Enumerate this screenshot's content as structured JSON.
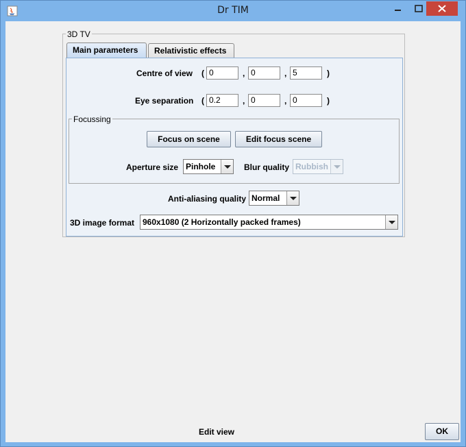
{
  "window": {
    "title": "Dr TIM"
  },
  "titlebar": {
    "minimize_icon": "minimize-icon",
    "maximize_icon": "maximize-icon",
    "close_icon": "close-icon"
  },
  "group": {
    "title": "3D TV"
  },
  "tabs": [
    {
      "label": "Main parameters",
      "selected": true
    },
    {
      "label": "Relativistic effects",
      "selected": false
    }
  ],
  "centre_of_view": {
    "label": "Centre of view",
    "x": "0",
    "y": "0",
    "z": "5"
  },
  "eye_separation": {
    "label": "Eye separation",
    "x": "0.2",
    "y": "0",
    "z": "0"
  },
  "punct": {
    "open": "(",
    "close": ")",
    "comma": ","
  },
  "focussing": {
    "title": "Focussing",
    "focus_button": "Focus on scene",
    "edit_button": "Edit focus scene",
    "aperture_label": "Aperture size",
    "aperture_value": "Pinhole",
    "blur_label": "Blur quality",
    "blur_value": "Rubbish"
  },
  "anti_aliasing": {
    "label": "Anti-aliasing quality",
    "value": "Normal"
  },
  "image_format": {
    "label": "3D image format",
    "value": "960x1080 (2 Horizontally packed frames)"
  },
  "status": {
    "text": "Edit view"
  },
  "ok_button": {
    "label": "OK"
  },
  "colors": {
    "titlebar": "#7eb4ea",
    "close": "#c7453b",
    "tab_panel": "#edf2f8"
  }
}
